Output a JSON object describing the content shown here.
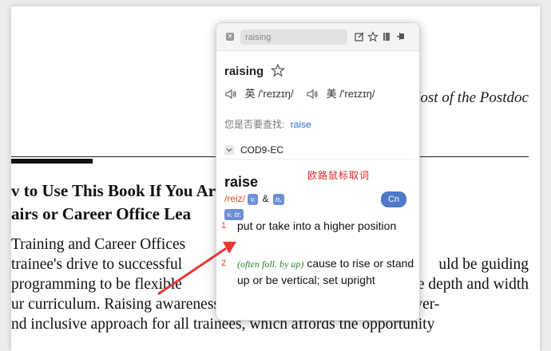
{
  "document": {
    "running_head": "Making the Most of the Postdoc",
    "section_title_lines": [
      "v to Use This Book If You Are a Postdoc",
      "airs or Career Office Lea"
    ],
    "body_lines": [
      " Training and Career Offices",
      "trainee's drive to successful",
      "programming to be flexible",
      "ur curriculum. Raising awareness in career-related topics is a univer-",
      "nd inclusive approach for all trainees, which affords the opportunity"
    ],
    "body_right_fragments": [
      "uld be guiding",
      "e depth and width"
    ]
  },
  "popup": {
    "search_value": "raising",
    "query": "raising",
    "phonetics": [
      {
        "region": "英",
        "ipa": "/'reɪzɪŋ/"
      },
      {
        "region": "美",
        "ipa": "/'reɪzɪŋ/"
      }
    ],
    "suggestion_prefix": "您是否要查找:",
    "suggestion_link": "raise",
    "dictionary_name": "COD9-EC",
    "hint": "欧路鼠标取词",
    "entry": {
      "word": "raise",
      "pronunciation": "/reiz/",
      "pos": [
        "v.",
        "n."
      ],
      "amp": "&",
      "pos_sub": "v. tr.",
      "lang_button": "Cn",
      "senses": [
        {
          "num": "1",
          "note": "",
          "text": "put or take into a higher position"
        },
        {
          "num": "2",
          "note": "(often foll. by up)",
          "text": "cause to rise or stand up or be vertical; set upright"
        }
      ]
    }
  },
  "colors": {
    "accent_blue": "#4e79c9",
    "pron_orange": "#d9481c",
    "hint_red": "#e02020",
    "arrow_red": "#e53935"
  }
}
